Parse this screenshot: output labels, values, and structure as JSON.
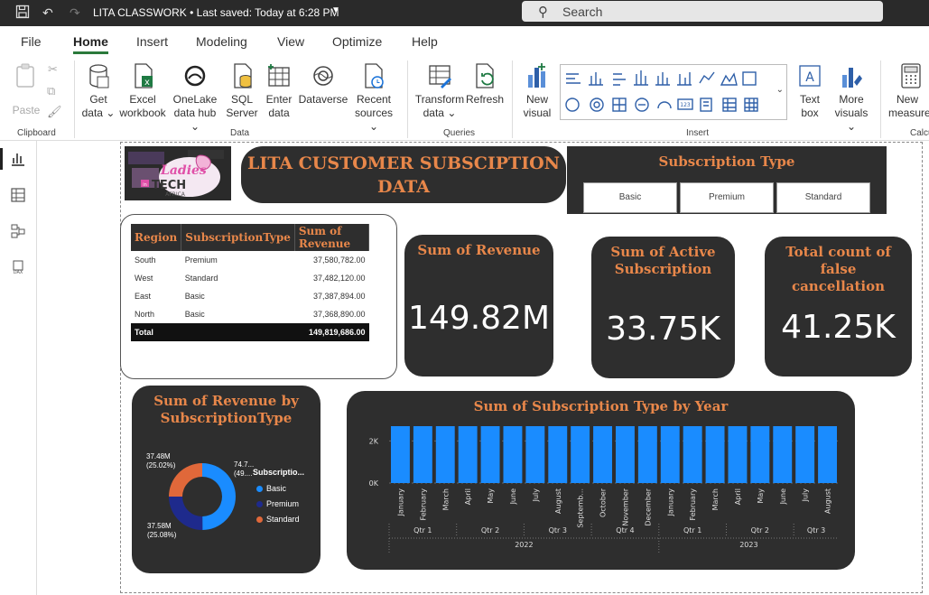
{
  "titlebar": {
    "doc_title": "LITA CLASSWORK • Last saved: Today at 6:28 PM",
    "search_placeholder": "Search"
  },
  "menu": {
    "tabs": [
      "File",
      "Home",
      "Insert",
      "Modeling",
      "View",
      "Optimize",
      "Help"
    ],
    "active": "Home"
  },
  "ribbon": {
    "paste": "Paste",
    "get_data": [
      "Get",
      "data ⌄"
    ],
    "excel": [
      "Excel",
      "workbook"
    ],
    "onelake": [
      "OneLake",
      "data hub ⌄"
    ],
    "sql": [
      "SQL",
      "Server"
    ],
    "enter_data": [
      "Enter",
      "data"
    ],
    "dataverse": "Dataverse",
    "recent": [
      "Recent",
      "sources ⌄"
    ],
    "transform": [
      "Transform",
      "data ⌄"
    ],
    "refresh": "Refresh",
    "new_visual": [
      "New",
      "visual"
    ],
    "text_box": [
      "Text",
      "box"
    ],
    "more_visuals": [
      "More",
      "visuals ⌄"
    ],
    "new_measure": [
      "New",
      "measure"
    ],
    "groups": {
      "clipboard": "Clipboard",
      "data": "Data",
      "queries": "Queries",
      "insert": "Insert",
      "calc": "Calcu"
    }
  },
  "report": {
    "main_title": "LITA CUSTOMER SUBSCIPTION DATA",
    "slicer": {
      "title": "Subscription Type",
      "options": [
        "Basic",
        "Premium",
        "Standard"
      ]
    },
    "table": {
      "headers": [
        "Region",
        "SubscriptionType",
        "Sum of Revenue"
      ],
      "rows": [
        [
          "South",
          "Premium",
          "37,580,782.00"
        ],
        [
          "West",
          "Standard",
          "37,482,120.00"
        ],
        [
          "East",
          "Basic",
          "37,387,894.00"
        ],
        [
          "North",
          "Basic",
          "37,368,890.00"
        ]
      ],
      "total_label": "Total",
      "total_value": "149,819,686.00"
    },
    "kpis": [
      {
        "title": "Sum of Revenue",
        "value": "149.82M"
      },
      {
        "title": "Sum of Active Subscription",
        "value": "33.75K"
      },
      {
        "title": "Total count of false cancellation",
        "value": "41.25K"
      }
    ],
    "donut": {
      "title": "Sum of Revenue by SubscriptionType",
      "legend_title": "Subscriptio...",
      "labels": {
        "top_left": [
          "37.48M",
          "(25.02%)"
        ],
        "bottom_left": [
          "37.58M",
          "(25.08%)"
        ],
        "right": [
          "74.7...",
          "(49...."
        ]
      }
    },
    "column_chart": {
      "title": "Sum of Subscription Type by Year",
      "y_ticks": [
        "2K",
        "0K"
      ],
      "quarters": [
        "Qtr 1",
        "Qtr 2",
        "Qtr 3",
        "Qtr 4",
        "Qtr 1",
        "Qtr 2",
        "Qtr 3"
      ],
      "years": [
        "2022",
        "2023"
      ]
    }
  },
  "colors": {
    "accent_orange": "#e8874a",
    "card_bg": "#2e2e2e",
    "bar_blue": "#1a8cff",
    "basic": "#1a8cff",
    "premium": "#1e2a8c",
    "standard": "#e0683a"
  },
  "chart_data": [
    {
      "type": "pie",
      "title": "Sum of Revenue by SubscriptionType",
      "legend_title": "Subscriptio...",
      "categories": [
        "Basic",
        "Premium",
        "Standard"
      ],
      "values": [
        74756784,
        37580782,
        37482120
      ],
      "legend_placement": "right"
    },
    {
      "type": "bar",
      "title": "Sum of Subscription Type by Year",
      "categories": [
        "January",
        "February",
        "March",
        "April",
        "May",
        "June",
        "July",
        "August",
        "Septemb...",
        "October",
        "November",
        "December",
        "January",
        "February",
        "March",
        "April",
        "May",
        "June",
        "July",
        "August"
      ],
      "values": [
        2700,
        2700,
        2700,
        2700,
        2700,
        2700,
        2700,
        2700,
        2700,
        2700,
        2700,
        2700,
        2700,
        2700,
        2700,
        2700,
        2700,
        2700,
        2700,
        2700
      ],
      "ylim": [
        0,
        3000
      ],
      "y_ticks": [
        "2K",
        "0K"
      ],
      "grid": true
    }
  ]
}
